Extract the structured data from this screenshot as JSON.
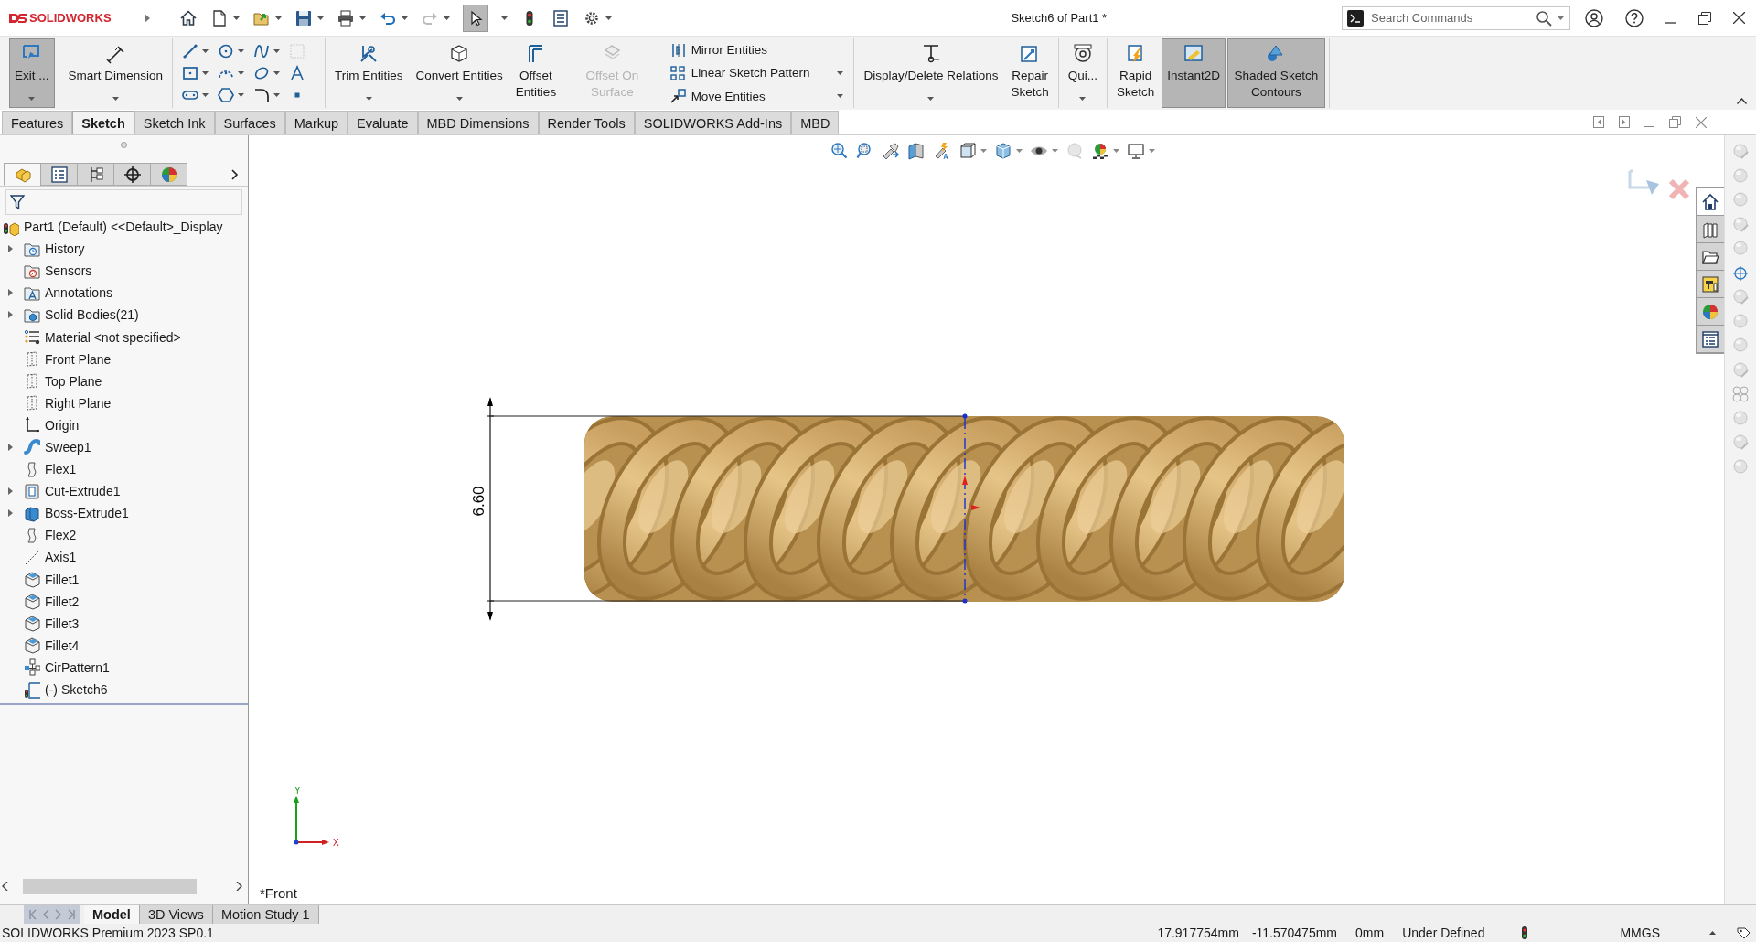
{
  "app": {
    "brand": "SOLIDWORKS"
  },
  "window": {
    "title": "Sketch6 of Part1 *"
  },
  "search": {
    "placeholder": "Search Commands"
  },
  "ribbon": [
    {
      "items": [
        {
          "kind": "large",
          "label": "Exit ...",
          "dropdown": true,
          "selected": true,
          "disabled": false
        }
      ]
    },
    {
      "items": [
        {
          "kind": "large",
          "label": "Smart Dimension",
          "dropdown": true,
          "selected": false,
          "disabled": false
        }
      ]
    },
    {
      "items": [
        {
          "kind": "grid"
        }
      ]
    },
    {
      "items": [
        {
          "kind": "large",
          "label": "Trim Entities",
          "dropdown": true,
          "selected": false,
          "disabled": false
        },
        {
          "kind": "large",
          "label": "Convert Entities",
          "dropdown": true,
          "selected": false,
          "disabled": false
        },
        {
          "kind": "large",
          "label": "Offset Entities",
          "dropdown": false,
          "selected": false,
          "disabled": false
        },
        {
          "kind": "large",
          "label": "Offset On Surface",
          "dropdown": false,
          "selected": false,
          "disabled": true
        },
        {
          "kind": "small",
          "label": "Mirror Entities",
          "dropdown": false
        },
        {
          "kind": "small",
          "label": "Linear Sketch Pattern",
          "dropdown": true
        },
        {
          "kind": "small",
          "label": "Move Entities",
          "dropdown": true
        }
      ]
    },
    {
      "items": [
        {
          "kind": "large",
          "label": "Display/Delete Relations",
          "dropdown": true,
          "selected": false,
          "disabled": false
        },
        {
          "kind": "large",
          "label": "Repair Sketch",
          "dropdown": false,
          "selected": false,
          "disabled": false
        }
      ]
    },
    {
      "items": [
        {
          "kind": "large",
          "label": "Qui...",
          "dropdown": true,
          "selected": false,
          "disabled": false
        }
      ]
    },
    {
      "items": [
        {
          "kind": "large",
          "label": "Rapid Sketch",
          "dropdown": false,
          "selected": false,
          "disabled": false
        },
        {
          "kind": "large",
          "label": "Instant2D",
          "dropdown": false,
          "selected": true,
          "disabled": false
        },
        {
          "kind": "large",
          "label": "Shaded Sketch Contours",
          "dropdown": false,
          "selected": true,
          "disabled": false
        }
      ]
    }
  ],
  "tabs": [
    {
      "label": "Features",
      "selected": false
    },
    {
      "label": "Sketch",
      "selected": true
    },
    {
      "label": "Sketch Ink",
      "selected": false
    },
    {
      "label": "Surfaces",
      "selected": false
    },
    {
      "label": "Markup",
      "selected": false
    },
    {
      "label": "Evaluate",
      "selected": false
    },
    {
      "label": "MBD Dimensions",
      "selected": false
    },
    {
      "label": "Render Tools",
      "selected": false
    },
    {
      "label": "SOLIDWORKS Add-Ins",
      "selected": false
    },
    {
      "label": "MBD",
      "selected": false
    }
  ],
  "panel_tabs": [
    {
      "kind": "feature-tree",
      "selected": true
    },
    {
      "kind": "properties",
      "selected": false
    },
    {
      "kind": "configurations",
      "selected": false
    },
    {
      "kind": "dimxpert",
      "selected": false
    },
    {
      "kind": "display",
      "selected": false
    }
  ],
  "tree": [
    {
      "label": "Part1 (Default) <<Default>_Display",
      "kind": "part",
      "expandable": false,
      "children": [
        {
          "label": "History",
          "kind": "history",
          "expandable": true
        },
        {
          "label": "Sensors",
          "kind": "sensors",
          "expandable": false
        },
        {
          "label": "Annotations",
          "kind": "annotations",
          "expandable": true
        },
        {
          "label": "Solid Bodies(21)",
          "kind": "bodies",
          "expandable": true
        },
        {
          "label": "Material <not specified>",
          "kind": "material",
          "expandable": false
        },
        {
          "label": "Front Plane",
          "kind": "plane",
          "expandable": false
        },
        {
          "label": "Top Plane",
          "kind": "plane",
          "expandable": false
        },
        {
          "label": "Right Plane",
          "kind": "plane",
          "expandable": false
        },
        {
          "label": "Origin",
          "kind": "origin",
          "expandable": false
        },
        {
          "label": "Sweep1",
          "kind": "sweep",
          "expandable": true
        },
        {
          "label": "Flex1",
          "kind": "flex",
          "expandable": false
        },
        {
          "label": "Cut-Extrude1",
          "kind": "cut-extrude",
          "expandable": true
        },
        {
          "label": "Boss-Extrude1",
          "kind": "boss-extrude",
          "expandable": true
        },
        {
          "label": "Flex2",
          "kind": "flex",
          "expandable": false
        },
        {
          "label": "Axis1",
          "kind": "axis",
          "expandable": false
        },
        {
          "label": "Fillet1",
          "kind": "fillet",
          "expandable": false
        },
        {
          "label": "Fillet2",
          "kind": "fillet",
          "expandable": false
        },
        {
          "label": "Fillet3",
          "kind": "fillet",
          "expandable": false
        },
        {
          "label": "Fillet4",
          "kind": "fillet",
          "expandable": false
        },
        {
          "label": "CirPattern1",
          "kind": "pattern",
          "expandable": false
        },
        {
          "label": "(-) Sketch6",
          "kind": "sketch",
          "expandable": false
        }
      ]
    }
  ],
  "viewport": {
    "view_name": "*Front",
    "dimension": "6.60",
    "triad": {
      "y_label": "Y",
      "x_label": "X"
    }
  },
  "task_pane_tabs": [
    {
      "kind": "home",
      "selected": true
    },
    {
      "kind": "library",
      "selected": false
    },
    {
      "kind": "folder",
      "selected": false
    },
    {
      "kind": "palette",
      "selected": false
    },
    {
      "kind": "appearance",
      "selected": false
    },
    {
      "kind": "properties",
      "selected": false
    }
  ],
  "bottom_tabs": [
    {
      "label": "Model",
      "selected": true
    },
    {
      "label": "3D Views",
      "selected": false
    },
    {
      "label": "Motion Study 1",
      "selected": false
    }
  ],
  "status_bar": {
    "product": "SOLIDWORKS Premium 2023 SP0.1",
    "x": "17.917754mm",
    "y": "-11.570475mm",
    "z": "0mm",
    "state": "Under Defined",
    "units": "MMGS"
  }
}
